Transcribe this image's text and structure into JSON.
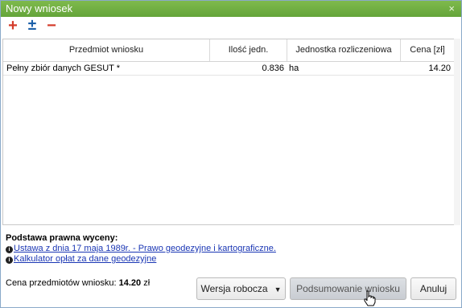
{
  "dialog": {
    "title": "Nowy wniosek",
    "close_glyph": "×"
  },
  "toolbar": {
    "add_glyph": "+",
    "plusminus_glyph": "±",
    "remove_glyph": "−"
  },
  "table": {
    "columns": [
      "Przedmiot wniosku",
      "Ilość jedn.",
      "Jednostka rozliczeniowa",
      "Cena [zł]"
    ],
    "rows": [
      {
        "item": "Pełny zbiór danych GESUT *",
        "quantity": "0.836",
        "unit": "ha",
        "price": "14.20"
      }
    ]
  },
  "legal": {
    "heading": "Podstawa prawna wyceny:",
    "info_glyph": "i",
    "links": [
      "Ustawa z dnia 17 maja 1989r. - Prawo geodezyjne i kartograficzne.",
      "Kalkulator opłat za dane geodezyjne"
    ]
  },
  "summary": {
    "label": "Cena przedmiotów wniosku:",
    "value": "14.20",
    "currency": "zł"
  },
  "buttons": {
    "draft": "Wersja robocza",
    "draft_arrow": "▼",
    "submit": "Podsumowanie wniosku",
    "cancel": "Anuluj"
  }
}
